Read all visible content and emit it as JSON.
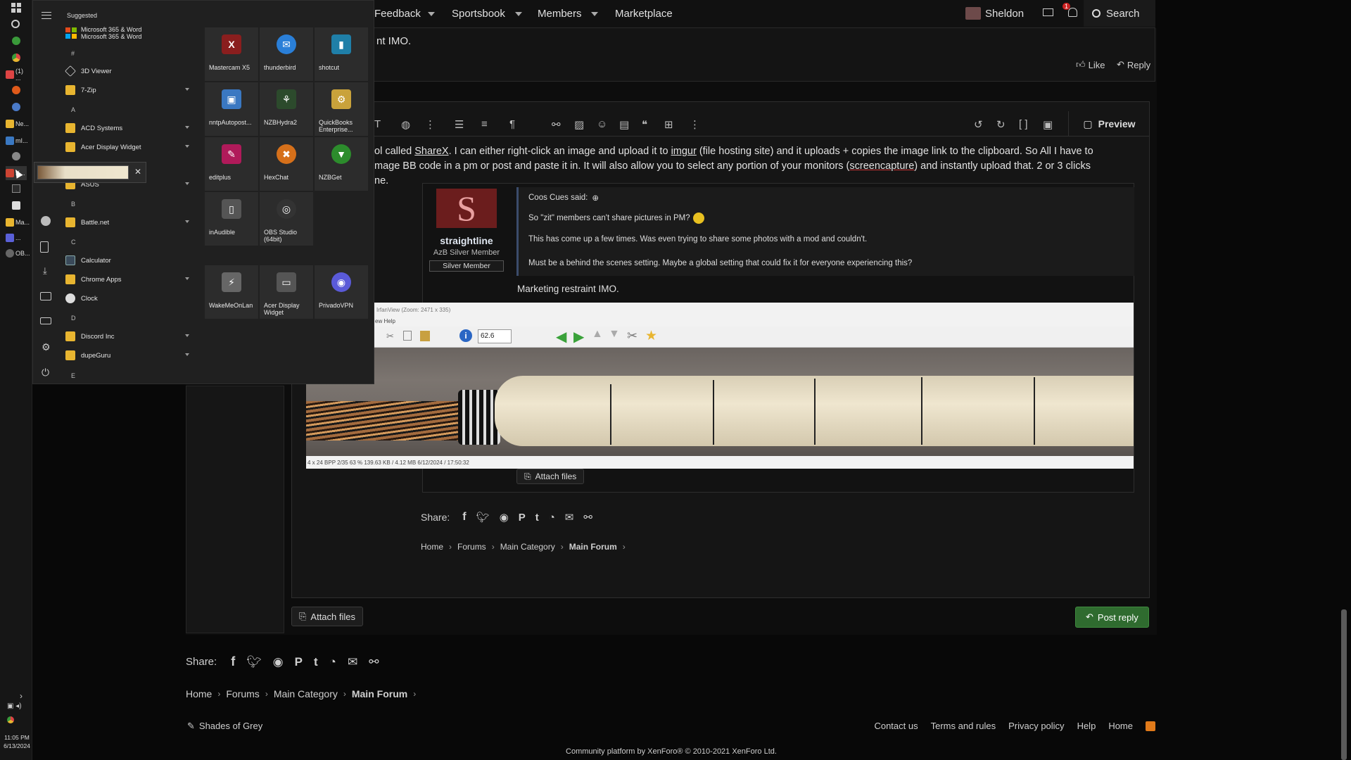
{
  "taskbar": {
    "items": [
      {
        "label": "(1) ...",
        "color": "#d44"
      },
      {
        "label": "Ne...",
        "color": "#e8b530"
      },
      {
        "label": "mI...",
        "color": "#3a78c2"
      },
      {
        "label": "X...",
        "color": "#c43"
      },
      {
        "label": "Ma...",
        "color": "#e8b530"
      },
      {
        "label": "...",
        "color": "#5a60d8"
      },
      {
        "label": "OB...",
        "color": "#666"
      }
    ],
    "clock_time": "11:05 PM",
    "clock_date": "6/13/2024"
  },
  "nav": {
    "feedback": "Feedback",
    "sportsbook": "Sportsbook",
    "members": "Members",
    "marketplace": "Marketplace",
    "user": "Sheldon",
    "alert_count": "1",
    "search": "Search"
  },
  "post_top": {
    "text": "nt IMO.",
    "like": "Like",
    "reply": "Reply"
  },
  "editor": {
    "preview": "Preview",
    "line1_a": "ol called ",
    "line1_link1": "ShareX",
    "line1_b": ". I can either right-click an image and upload it to ",
    "line1_link2": "imgur",
    "line1_c": " (file hosting site) and it uploads + copies the image link to the clipboard. So All I have to",
    "line2_a": "mage BB code in a pm or post and paste it in. It will also allow you to select any portion of your monitors (",
    "line2_link": "screencapture",
    "line2_b": ") and instantly upload that. 2 or 3 clicks",
    "line3": "ne."
  },
  "quote": {
    "avatar_letter": "S",
    "username": "straightline",
    "user_title": "AzB Silver Member",
    "badge": "Silver Member",
    "author": "Coos Cues said:",
    "line1": "So \"zit\" members can't share pictures in PM?",
    "line2": "This has come up a few times. Was even trying to share some photos with a mod and couldn't.",
    "line3": "Must be a behind the scenes setting. Maybe a global setting that could fix it for everyone experiencing this?",
    "reply_text": "Marketing restraint IMO.",
    "img_title": "IrfanView (Zoom: 2471 x 335)",
    "img_menu": "ew    Help",
    "img_zoom": "62.6",
    "img_status": "4 x 24 BPP     2/35     63 %     139.63 KB / 4.12 MB     6/12/2024 / 17:50:32",
    "attach": "Attach files"
  },
  "inner_share": {
    "label": "Share:",
    "crumbs": [
      "Home",
      "Forums",
      "Main Category",
      "Main Forum"
    ]
  },
  "actions": {
    "attach": "Attach files",
    "post_reply": "Post reply"
  },
  "outer_share": {
    "label": "Share:",
    "crumbs": [
      "Home",
      "Forums",
      "Main Category",
      "Main Forum"
    ]
  },
  "footer": {
    "style": "Shades of Grey",
    "links": [
      "Contact us",
      "Terms and rules",
      "Privacy policy",
      "Help",
      "Home"
    ],
    "copyright": "Community platform by XenForo® © 2010-2021 XenForo Ltd."
  },
  "start_menu": {
    "suggested": "Suggested",
    "suggested_app": "Microsoft 365 & Word",
    "suggested_app_sub": "Microsoft 365 & Word",
    "letters": [
      "#",
      "A",
      "B",
      "C",
      "D",
      "E"
    ],
    "apps": [
      {
        "name": "3D Viewer",
        "folder": false
      },
      {
        "name": "7-Zip",
        "folder": true
      },
      {
        "name": "ACD Systems",
        "folder": true
      },
      {
        "name": "Acer Display Widget",
        "folder": true
      },
      {
        "name": "ASUS",
        "folder": true
      },
      {
        "name": "Battle.net",
        "folder": true
      },
      {
        "name": "Calculator",
        "folder": false
      },
      {
        "name": "Chrome Apps",
        "folder": true
      },
      {
        "name": "Clock",
        "folder": false
      },
      {
        "name": "Discord Inc",
        "folder": true
      },
      {
        "name": "dupeGuru",
        "folder": true
      }
    ],
    "tiles": [
      {
        "name": "Mastercam X5",
        "color": "#8a1e1e",
        "glyph": "X"
      },
      {
        "name": "thunderbird",
        "color": "#2a7fd8",
        "glyph": "✉"
      },
      {
        "name": "shotcut",
        "color": "#1f7fa8",
        "glyph": "▮"
      },
      {
        "name": "nntpAutopost...",
        "color": "#3a78c2",
        "glyph": "▣"
      },
      {
        "name": "NZBHydra2",
        "color": "#2c4a2c",
        "glyph": "⚘"
      },
      {
        "name": "QuickBooks Enterprise...",
        "color": "#c9a23b",
        "glyph": "⚙"
      },
      {
        "name": "editplus",
        "color": "#b01a5a",
        "glyph": "✎"
      },
      {
        "name": "HexChat",
        "color": "#d6701a",
        "glyph": "✖"
      },
      {
        "name": "NZBGet",
        "color": "#2c8c2c",
        "glyph": "▼"
      },
      {
        "name": "inAudible",
        "color": "#555",
        "glyph": "▯"
      },
      {
        "name": "OBS Studio (64bit)",
        "color": "#333",
        "glyph": "◎"
      },
      {
        "name": "WakeMeOnLan",
        "color": "#666",
        "glyph": "⚡"
      },
      {
        "name": "Acer Display Widget",
        "color": "#555",
        "glyph": "▭"
      },
      {
        "name": "PrivadoVPN",
        "color": "#5a5ad8",
        "glyph": "◉"
      }
    ]
  }
}
